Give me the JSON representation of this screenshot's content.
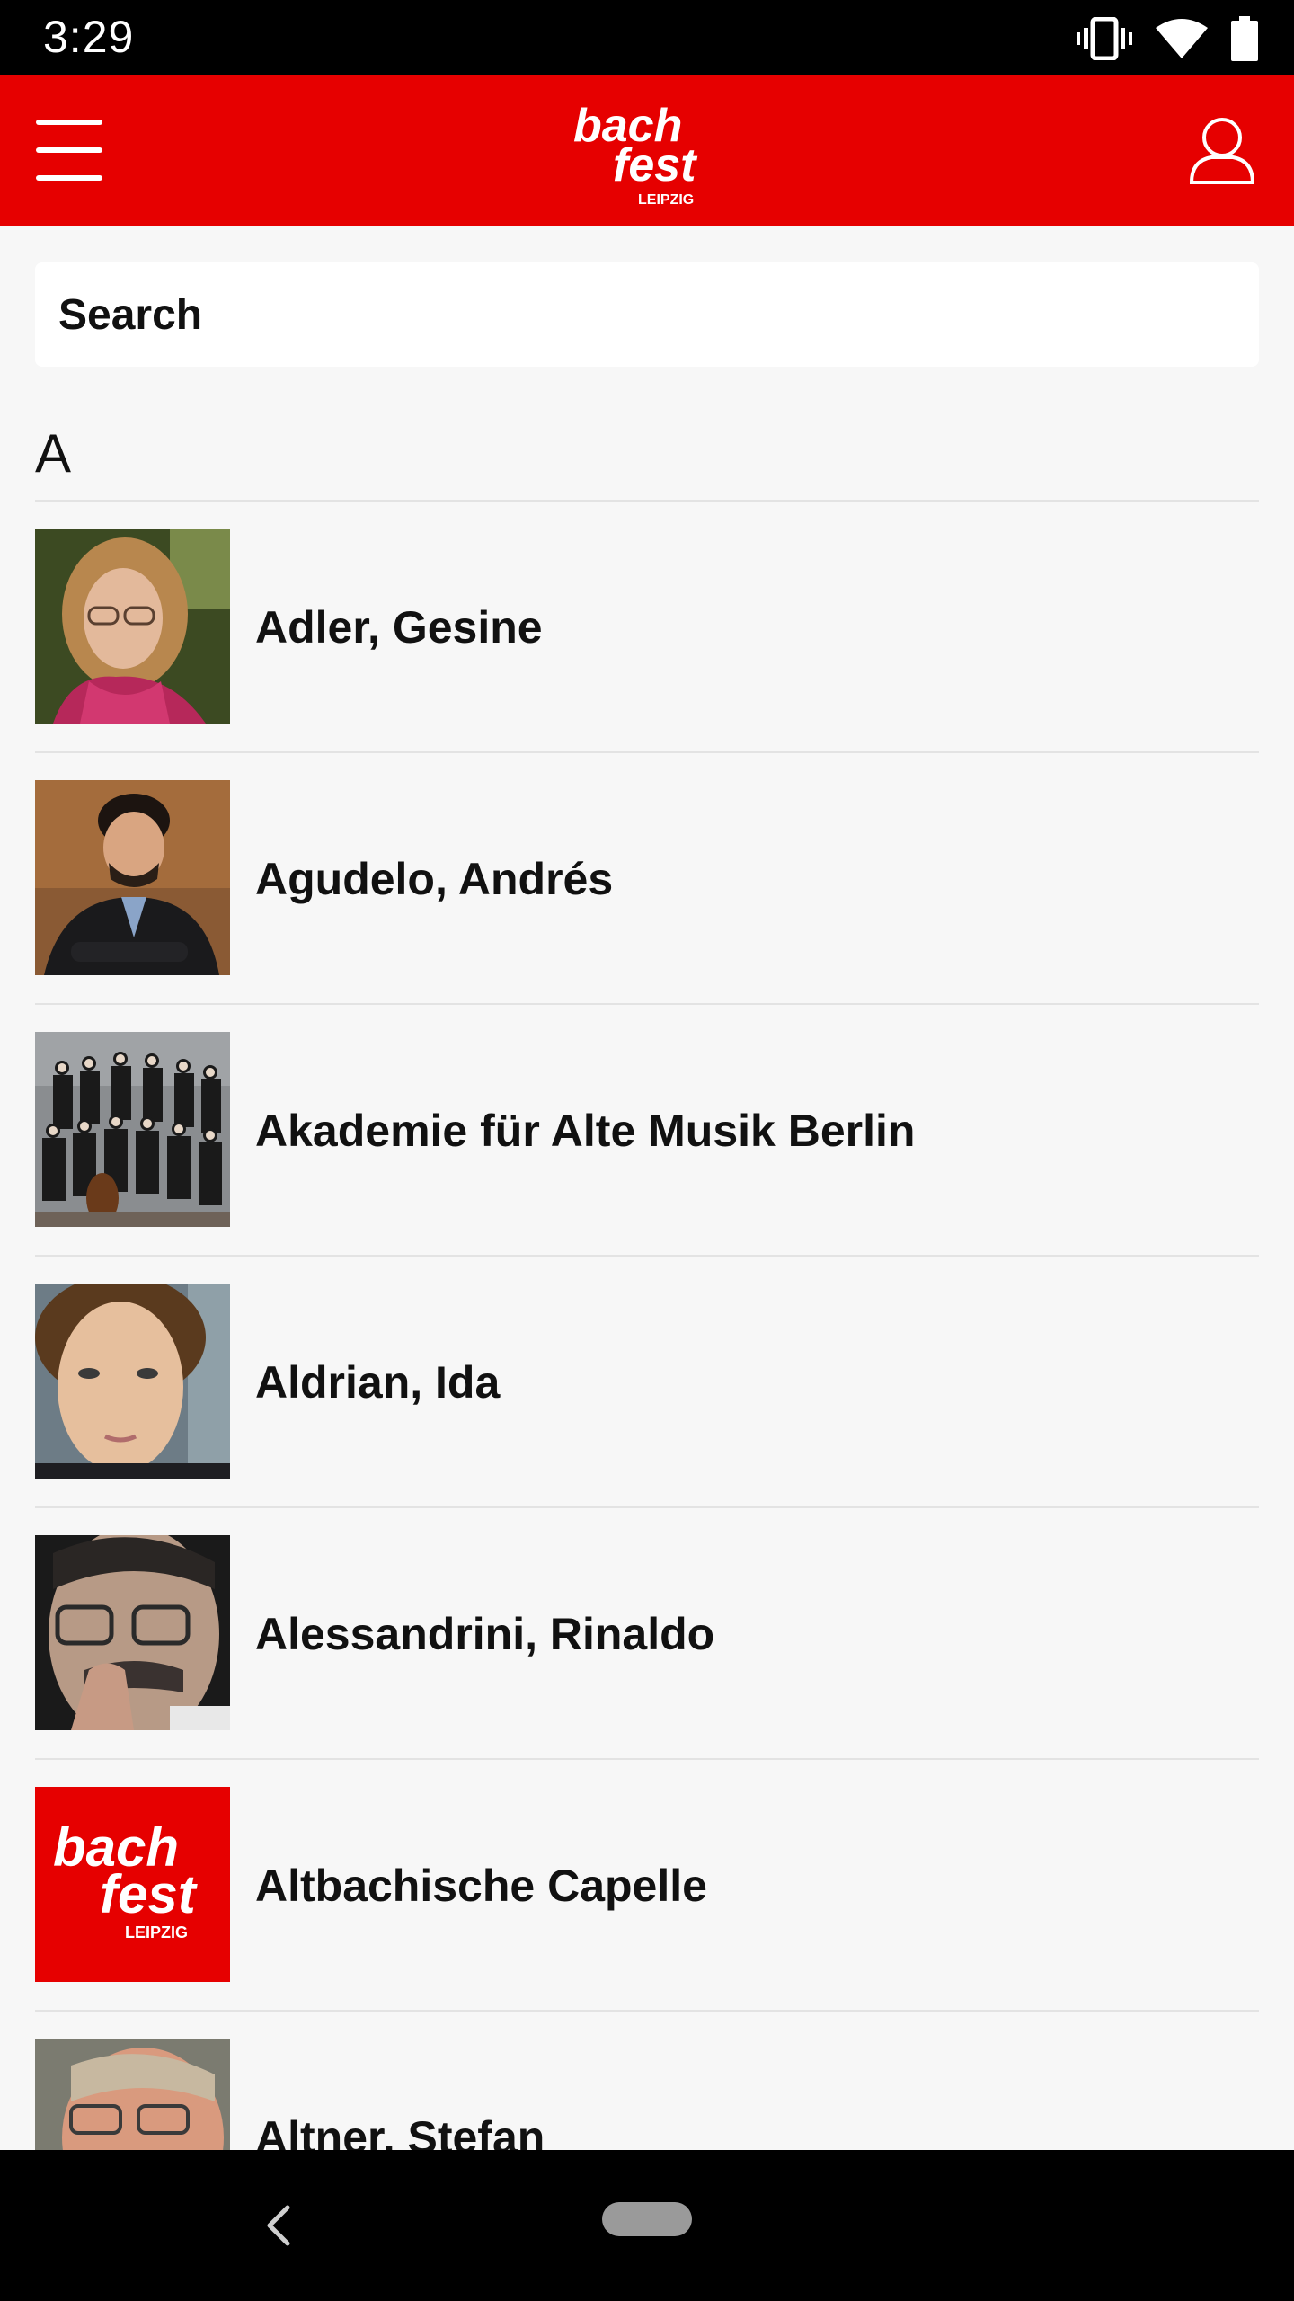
{
  "status_bar": {
    "time": "3:29",
    "icons": [
      "vibrate-icon",
      "wifi-icon",
      "battery-icon"
    ]
  },
  "app_bar": {
    "menu_icon": "menu-icon",
    "logo": {
      "line1": "bach",
      "line2": "fest",
      "line3": "LEIPZIG"
    },
    "profile_icon": "user-icon",
    "color": "#e60000"
  },
  "search": {
    "placeholder": "Search"
  },
  "sections": [
    {
      "letter": "A",
      "items": [
        {
          "name": "Adler, Gesine"
        },
        {
          "name": "Agudelo, Andrés"
        },
        {
          "name": "Akademie für Alte Musik Berlin"
        },
        {
          "name": "Aldrian, Ida"
        },
        {
          "name": "Alessandrini, Rinaldo"
        },
        {
          "name": "Altbachische Capelle"
        },
        {
          "name": "Altner, Stefan"
        }
      ]
    }
  ],
  "nav_bar": {
    "back_icon": "back-icon",
    "home_icon": "home-pill-icon"
  }
}
